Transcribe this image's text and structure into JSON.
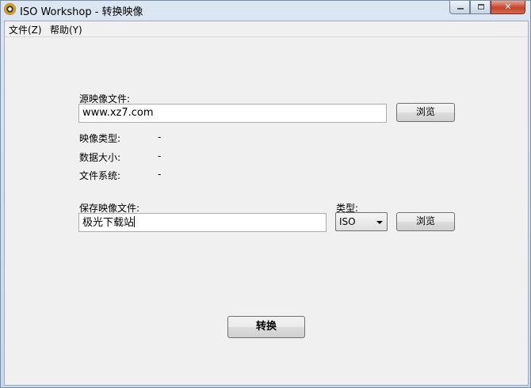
{
  "window": {
    "title": "ISO Workshop - 转换映像",
    "controls": {
      "minimize_icon": "minimize-icon",
      "maximize_icon": "maximize-icon",
      "close_icon": "close-icon",
      "close_glyph": "✕"
    }
  },
  "menubar": {
    "items": [
      {
        "label": "文件(Z)"
      },
      {
        "label": "帮助(Y)"
      }
    ]
  },
  "source": {
    "label": "源映像文件:",
    "value": "www.xz7.com",
    "browse_label": "浏览"
  },
  "info": {
    "image_type_label": "映像类型:",
    "image_type_value": "-",
    "data_size_label": "数据大小:",
    "data_size_value": "-",
    "filesystem_label": "文件系统:",
    "filesystem_value": "-"
  },
  "target": {
    "label": "保存映像文件:",
    "value": "极光下载站",
    "type_label": "类型:",
    "type_selected": "ISO",
    "browse_label": "浏览"
  },
  "convert_label": "转换"
}
